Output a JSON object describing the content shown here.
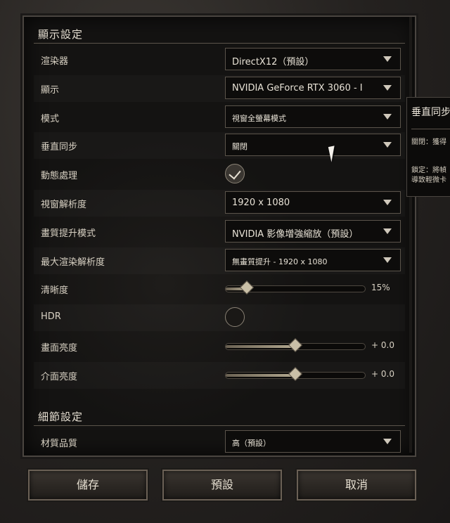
{
  "display": {
    "title": "顯示設定",
    "rows": [
      {
        "label": "渲染器",
        "type": "dropdown",
        "value": "DirectX12（預設）"
      },
      {
        "label": "顯示",
        "type": "dropdown",
        "value": "NVIDIA GeForce RTX 3060 - I"
      },
      {
        "label": "模式",
        "type": "dropdown",
        "value": "視窗全螢幕模式",
        "small": true
      },
      {
        "label": "垂直同步",
        "type": "dropdown",
        "value": "關閉",
        "small": true
      },
      {
        "label": "動態處理",
        "type": "checkbox",
        "checked": true
      },
      {
        "label": "視窗解析度",
        "type": "dropdown",
        "value": "1920 x 1080"
      },
      {
        "label": "畫質提升模式",
        "type": "dropdown",
        "value": "NVIDIA 影像增強縮放（預設）"
      },
      {
        "label": "最大渲染解析度",
        "type": "dropdown",
        "value": "無畫質提升 - 1920 x 1080",
        "small": true
      },
      {
        "label": "清晰度",
        "type": "slider",
        "fraction": 0.15,
        "value_text": "15%"
      },
      {
        "label": "HDR",
        "type": "checkbox",
        "checked": false
      },
      {
        "label": "畫面亮度",
        "type": "slider",
        "fraction": 0.5,
        "value_text": "+ 0.0"
      },
      {
        "label": "介面亮度",
        "type": "slider",
        "fraction": 0.5,
        "value_text": "+ 0.0"
      }
    ]
  },
  "detail": {
    "title": "細節設定",
    "rows": [
      {
        "label": "材質品質",
        "type": "dropdown",
        "value": "高（預設）",
        "small": true
      }
    ]
  },
  "tooltip": {
    "title": "垂直同步",
    "lines": [
      "關閉：獲得",
      "鎖定：將幀",
      "導致輕微卡"
    ]
  },
  "buttons": {
    "save": "儲存",
    "default": "預設",
    "cancel": "取消"
  }
}
